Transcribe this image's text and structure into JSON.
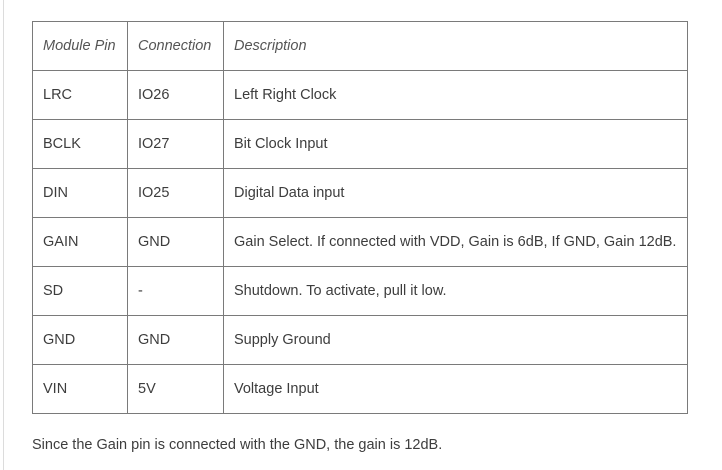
{
  "table": {
    "headers": [
      "Module Pin",
      "Connection",
      "Description"
    ],
    "rows": [
      [
        "LRC",
        "IO26",
        "Left Right Clock"
      ],
      [
        "BCLK",
        "IO27",
        "Bit Clock Input"
      ],
      [
        "DIN",
        "IO25",
        "Digital Data input"
      ],
      [
        "GAIN",
        "GND",
        "Gain Select. If connected with VDD, Gain is 6dB, If GND, Gain 12dB."
      ],
      [
        "SD",
        "-",
        "Shutdown. To activate, pull it low."
      ],
      [
        "GND",
        "GND",
        "Supply Ground"
      ],
      [
        "VIN",
        "5V",
        "Voltage Input"
      ]
    ]
  },
  "note": "Since the Gain pin is connected with the GND, the gain is 12dB."
}
